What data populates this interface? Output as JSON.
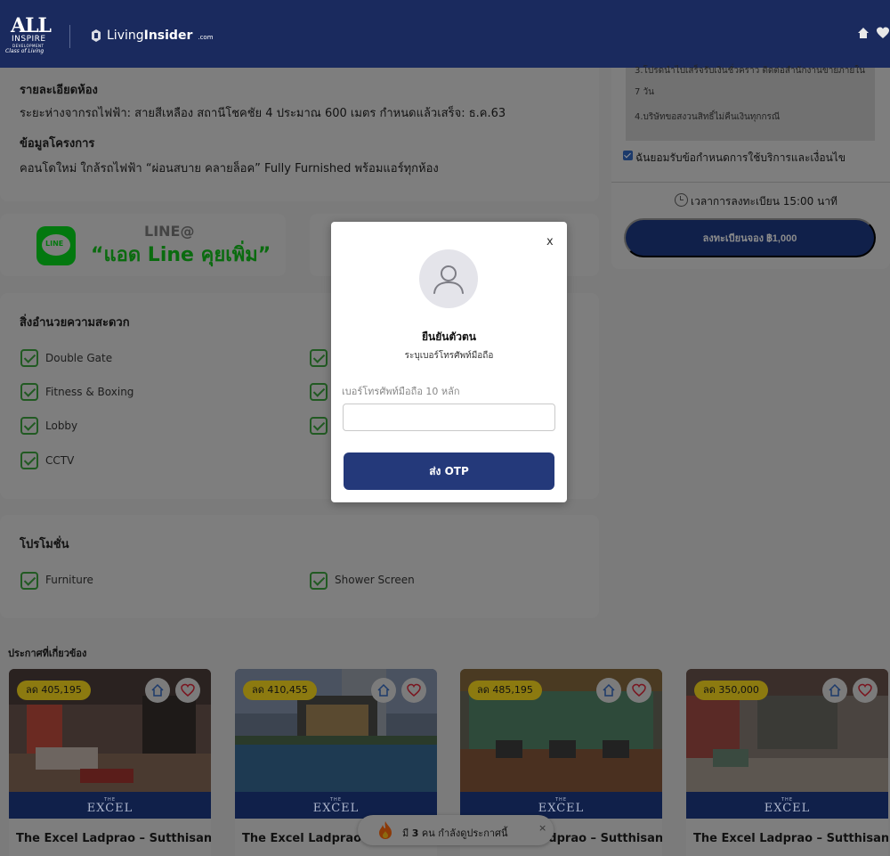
{
  "header": {
    "logo_main": "ALL",
    "logo_line2": "INSPIRE",
    "logo_line3": "DEVELOPMENT",
    "logo_tagline": "Class of Living",
    "partner_logo_regular": "Living",
    "partner_logo_bold": "Insider",
    "partner_logo_suffix": ".com"
  },
  "details": {
    "room_title": "รายละเอียดห้อง",
    "room_text": "ระยะห่างจากรถไฟฟ้า: สายสีเหลือง สถานีโชคชัย 4 ประมาณ 600 เมตร กำหนดแล้วเสร็จ: ธ.ค.63",
    "project_title": "ข้อมูลโครงการ",
    "project_text": "คอนโดใหม่ ใกล้รถไฟฟ้า “ผ่อนสบาย คลายล็อค” Fully Furnished พร้อมแอร์ทุกห้อง"
  },
  "line_card": {
    "logo_text": "LINE",
    "at_label": "LINE@",
    "headline": "“แอด Line คุยเพิ่ม”"
  },
  "facilities": {
    "title": "สิ่งอำนวยความสะดวก",
    "items": [
      "Double Gate",
      "Fitness & Boxing",
      "Lobby",
      "CCTV"
    ]
  },
  "promotion": {
    "title": "โปรโมชั่น",
    "items": [
      "Furniture",
      "Shower Screen"
    ]
  },
  "booking": {
    "term3_line1": "3.โปรดนำไปเสร็จรับเงินชั่วคราว ติดต่อสำนักงานขายภายใน",
    "term3_line2": "7 วัน",
    "term4": "4.บริษัทขอสงวนสิทธิ์ไม่คืนเงินทุกกรณี",
    "agree_text": "ฉันยอมรับข้อกำหนดการใช้บริการและเงื่อนไข",
    "timer_text": "เวลาการลงทะเบียน 15:00 นาที",
    "book_button": "ลงทะเบียนจอง ฿1,000"
  },
  "related": {
    "title": "ประกาศที่เกี่ยวข้อง",
    "cards": [
      {
        "badge": "ลด 405,195",
        "brand_the": "THE",
        "brand": "EXCEL",
        "name": "The Excel Ladprao – Sutthisan"
      },
      {
        "badge": "ลด 410,455",
        "brand_the": "THE",
        "brand": "EXCEL",
        "name": "The Excel Ladprao – Sutthisan"
      },
      {
        "badge": "ลด 485,195",
        "brand_the": "THE",
        "brand": "EXCEL",
        "name": "The Excel Ladprao – Sutthisan"
      },
      {
        "badge": "ลด 350,000",
        "brand_the": "THE",
        "brand": "EXCEL",
        "name": "The Excel Ladprao – Sutthisan"
      }
    ]
  },
  "viewers": {
    "prefix": "มี",
    "count": "3",
    "suffix": "คน กำลังดูประกาศนี้",
    "close": "×"
  },
  "modal": {
    "close": "x",
    "title": "ยืนยันตัวตน",
    "subtitle": "ระบุเบอร์โทรศัพท์มือถือ",
    "field_label": "เบอร์โทรศัพท์มือถือ 10 หลัก",
    "field_value": "",
    "submit": "ส่ง OTP"
  },
  "colors": {
    "header_bg": "#1a2a5e",
    "primary_button": "#24397a",
    "line_green": "#03780f",
    "badge_yellow": "#8c7a10"
  }
}
